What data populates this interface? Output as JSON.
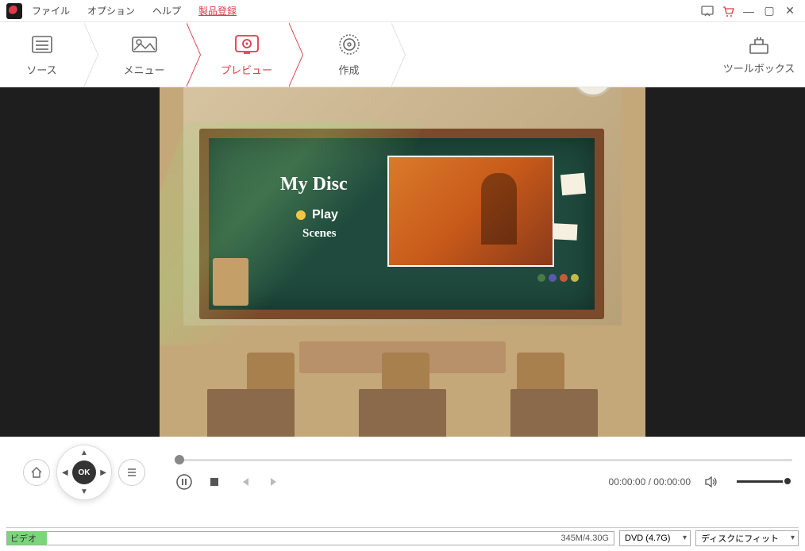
{
  "menu": {
    "file": "ファイル",
    "option": "オプション",
    "help": "ヘルプ",
    "register": "製品登録"
  },
  "tabs": {
    "source": "ソース",
    "menu": "メニュー",
    "preview": "プレビュー",
    "create": "作成"
  },
  "toolbox": {
    "label": "ツールボックス"
  },
  "disc_menu": {
    "title": "My Disc",
    "play": "Play",
    "scenes": "Scenes"
  },
  "player": {
    "ok": "OK",
    "time_current": "00:00:00",
    "time_sep": " / ",
    "time_total": "00:00:00"
  },
  "bottom": {
    "video_label": "ビデオ",
    "capacity": "345M/4.30G",
    "disc_type": "DVD (4.7G)",
    "fit": "ディスクにフィット"
  }
}
